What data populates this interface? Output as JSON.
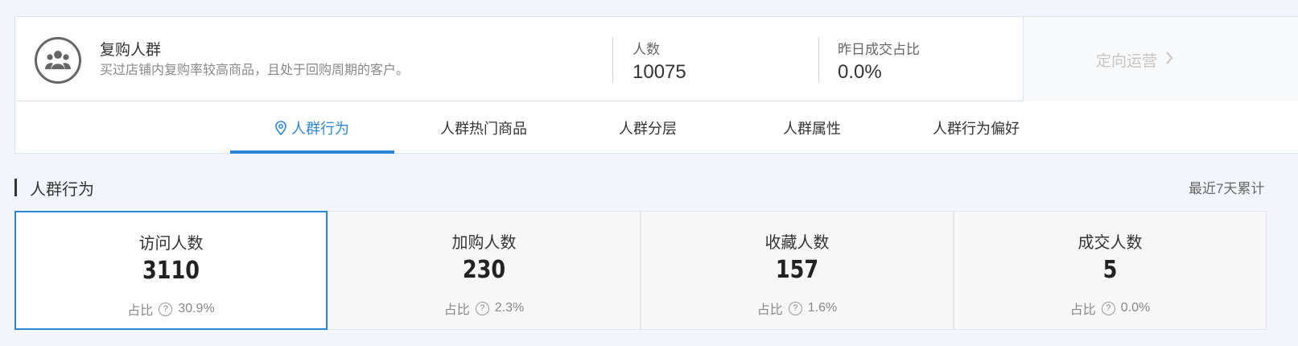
{
  "segment": {
    "title": "复购人群",
    "description": "买过店铺内复购率较高商品，且处于回购周期的客户。",
    "icon": "group-icon",
    "stats": [
      {
        "label": "人数",
        "value": "10075"
      },
      {
        "label": "昨日成交占比",
        "value": "0.0%"
      }
    ],
    "action_label": "定向运营",
    "action_icon": "chevron-right-icon"
  },
  "tabs": [
    {
      "label": "人群行为",
      "active": true,
      "icon": "location-pin-icon"
    },
    {
      "label": "人群热门商品"
    },
    {
      "label": "人群分层"
    },
    {
      "label": "人群属性"
    },
    {
      "label": "人群行为偏好"
    }
  ],
  "section": {
    "title": "人群行为",
    "note": "最近7天累计"
  },
  "metrics": [
    {
      "label": "访问人数",
      "value": "3110",
      "ratio_label": "占比",
      "ratio": "30.9%",
      "active": true
    },
    {
      "label": "加购人数",
      "value": "230",
      "ratio_label": "占比",
      "ratio": "2.3%"
    },
    {
      "label": "收藏人数",
      "value": "157",
      "ratio_label": "占比",
      "ratio": "1.6%"
    },
    {
      "label": "成交人数",
      "value": "5",
      "ratio_label": "占比",
      "ratio": "0.0%"
    }
  ],
  "colors": {
    "accent": "#2b86d9",
    "background": "#f2f6fc"
  }
}
